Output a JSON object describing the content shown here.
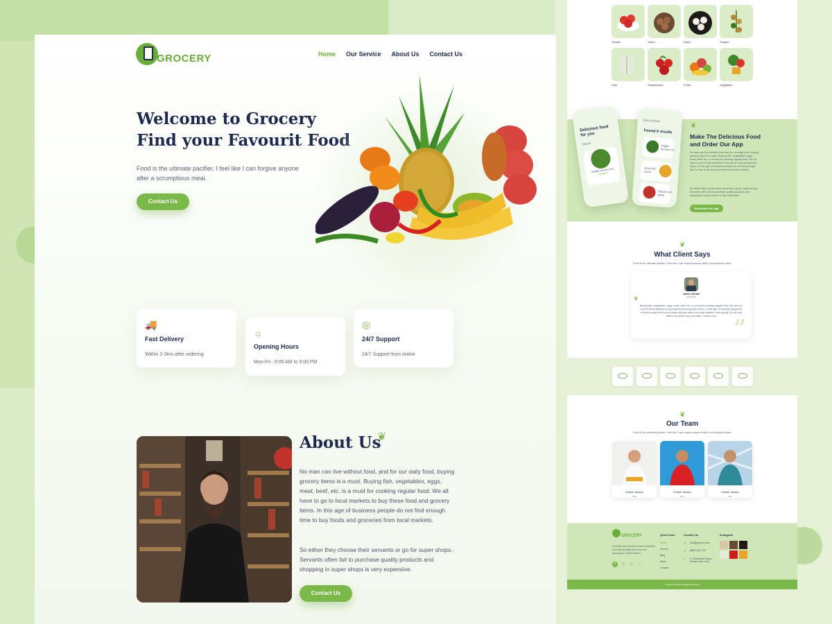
{
  "nav": {
    "logo_text": "GROCERY",
    "items": [
      "Home",
      "Our Service",
      "About Us",
      "Contact Us"
    ],
    "active": "Home"
  },
  "hero": {
    "title_line1": "Welcome to Grocery",
    "title_line2": "Find your Favourit Food",
    "description": "Food is the ultimate pacifier. I feel like I can forgive anyone after a scrumptious meal.",
    "cta": "Contact Us"
  },
  "features": [
    {
      "icon": "truck-icon",
      "title": "Fast Delivery",
      "desc": "Within 2-3hrs after ordering"
    },
    {
      "icon": "sun-icon",
      "title": "Opening Hours",
      "desc": "Mon-Fri : 9:00 AM to 9:00 PM"
    },
    {
      "icon": "headset-icon",
      "title": "24/7 Support",
      "desc": "24/7 Support from online"
    }
  ],
  "about": {
    "title": "About Us",
    "p1": "No man can live without food, and for our daily food, buying grocery items is a must. Buying fish, vegetables, eggs, meat, beef, etc. is a must for cooking regular food. We all have to go to local markets to buy these food and grocery items. In this age of business people do not find enough time to buy foods and groceries from local markets.",
    "p2": "So either they choose their servants or go for super shops. Servants often fail to purchase quality products and shopping in super shops is very expensive.",
    "cta": "Contact Us"
  },
  "categories": {
    "row1": [
      "Tomato",
      "Onion",
      "Garlic",
      "Grapes"
    ],
    "row2": [
      "Kale",
      "Strawberries",
      "Fruits",
      "Vegitables"
    ]
  },
  "app": {
    "title": "Make The Delicious Food and Order Our App",
    "p1": "No man can live without food and for our daily food, buying grocery items is a must. Buying fish, vegetables, eggs, meat, beef, etc. is a must for cooking regular food. We all have to go to local markets to buy these food and grocery items. In this age of business people do not find enough time to buy foods and groceries from local markets.",
    "p2": "So either they choose their servants or go for super shops. Servants often fail to purchase quality products and shopping in super shops is very expensive.",
    "cta": "Download the App",
    "phone1_title": "Delicious food for you",
    "phone1_search": "Search",
    "phone1_item": "Veggie tomato mix",
    "phone1_price": "N1,900",
    "phone2_header": "Spicy chicken",
    "phone2_title": "Found 6 results",
    "phone2_items": [
      "Veggie tomato mix",
      "Spicy fish sauce",
      "Natural red apple"
    ]
  },
  "testimonial": {
    "title": "What Client Says",
    "subtitle": "Food is the ultimate pacifier. I feel like I can forgive anyone after a scrumptious meal.",
    "name": "James Jordan",
    "role": "Customer",
    "quote": "Buying fish, vegetables, eggs, meat, beef, etc. is a must for cooking regular food. We all have to go to local markets to buy these food and grocery items. In this age of business people do not find enough time to buy foods and groceries from local markets. Keep going, it's the best deliver we would have provided. Thanks a lot!"
  },
  "team": {
    "title": "Our Team",
    "subtitle": "Food is the ultimate pacifier. I feel like I can forgive anyone after a scrumptious meal.",
    "members": [
      {
        "name": "Cristian Jackson",
        "role": "CEO"
      },
      {
        "name": "Cristian Jackson",
        "role": "CEO"
      },
      {
        "name": "Cristian Jackson",
        "role": "CEO"
      }
    ]
  },
  "footer": {
    "logo_text": "GROCERY",
    "about": "Incredible mix of America chefs is dedicated to providing quality diverse and rich landscape to mobile features.",
    "quick_links_title": "Quick links",
    "quick_links": [
      "Home",
      "Service",
      "Blog",
      "About",
      "Contact"
    ],
    "contact_title": "Contact Us",
    "contact": [
      "info@grocery.com",
      "(880) 100-716",
      "27 Boulevard Road, Dhaka, New York"
    ],
    "instagram_title": "Instagram",
    "copyright": "Copyright ©2021 All Rights Reserved"
  },
  "colors": {
    "accent": "#7bb84a",
    "navy": "#1d2a4d",
    "mint": "#d9ebc8"
  }
}
